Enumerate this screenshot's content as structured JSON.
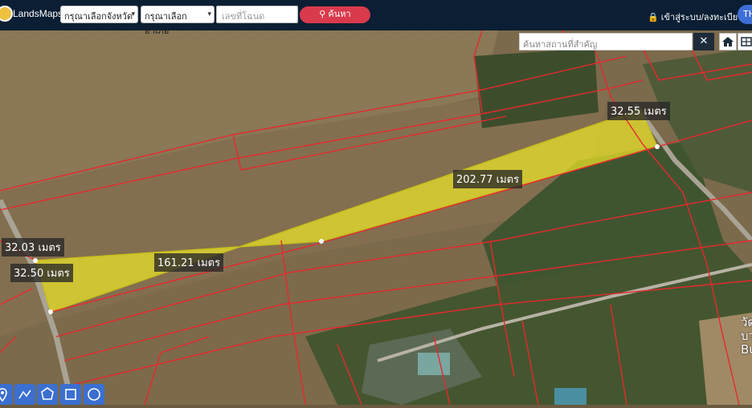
{
  "header": {
    "brand": "LandsMaps",
    "province_select": "กรุณาเลือกจังหวัด",
    "district_select": "กรุณาเลือกอำเภอ",
    "deed_placeholder": "เลขที่โฉนด",
    "search_label": "ค้นหา",
    "login_label": "เข้าสู่ระบบ/ลงทะเบียน",
    "lang_label": "TH"
  },
  "map": {
    "place_search_placeholder": "ค้นหาสถานที่สำคัญ",
    "clear_label": "✕",
    "measurements": {
      "top_edge": "32.55 เมตร",
      "long_edge": "202.77 เมตร",
      "left_edge_outer": "32.03 เมตร",
      "left_edge_inner": "32.50 เมตร",
      "bottom_edge": "161.21 เมตร"
    },
    "place_label_partial": "วัด บวก Bu",
    "highlight_color": "#e8e02a",
    "boundary_color": "#e8282e"
  },
  "tools": [
    "pin-tool",
    "polyline-tool",
    "polygon-tool",
    "rectangle-tool",
    "circle-tool"
  ]
}
